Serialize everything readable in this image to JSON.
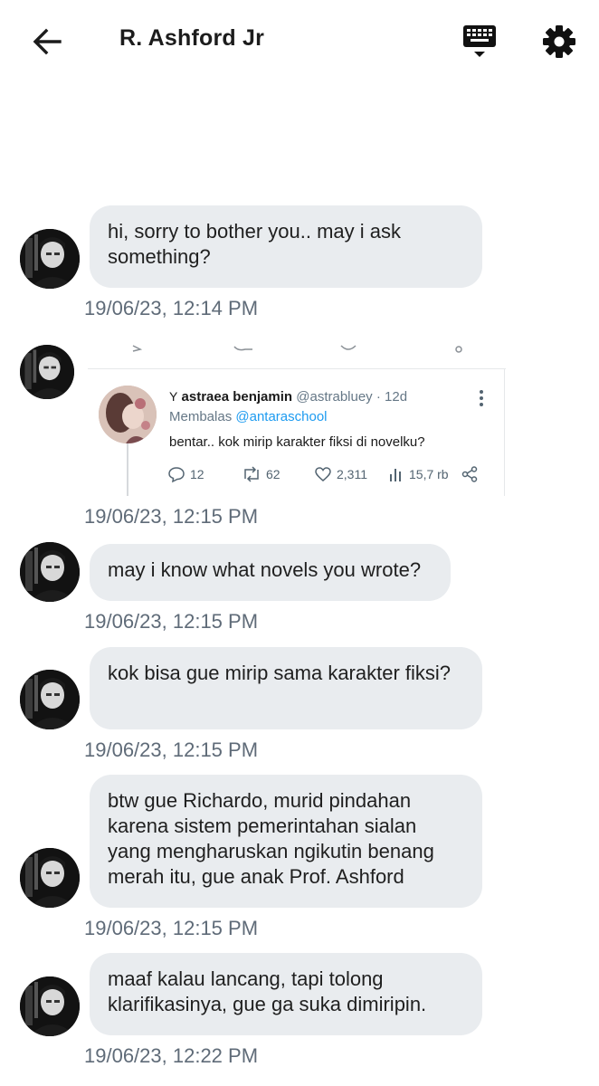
{
  "header": {
    "title": "R. Ashford Jr",
    "back_icon": "arrow-left-icon",
    "keyboard_icon": "keyboard-icon",
    "settings_icon": "gear-icon"
  },
  "messages": [
    {
      "text": "hi, sorry to bother you.. may i ask something?",
      "time": "19/06/23, 12:14 PM"
    },
    {
      "time": "19/06/23, 12:15 PM"
    },
    {
      "text": "may i know what novels you wrote?",
      "time": "19/06/23, 12:15 PM"
    },
    {
      "text": "kok bisa gue mirip sama karakter fiksi?",
      "time": "19/06/23, 12:15 PM"
    },
    {
      "text": "btw gue Richardo, murid pindahan karena sistem pemerintahan sialan yang mengharuskan ngikutin benang merah itu, gue anak Prof. Ashford",
      "time": "19/06/23, 12:15 PM"
    },
    {
      "text": "maaf kalau lancang, tapi tolong klarifikasinya, gue ga suka dimiripin.",
      "time": "19/06/23, 12:22 PM"
    }
  ],
  "tweet": {
    "name": "astraea benjamin",
    "handle": "@astrabluey",
    "age": "· 12d",
    "reply_prefix": "Membalas",
    "reply_to": "@antaraschool",
    "text": "bentar.. kok mirip karakter fiksi di novelku?",
    "replies": "12",
    "retweets": "62",
    "likes": "2,311",
    "views": "15,7 rb"
  }
}
